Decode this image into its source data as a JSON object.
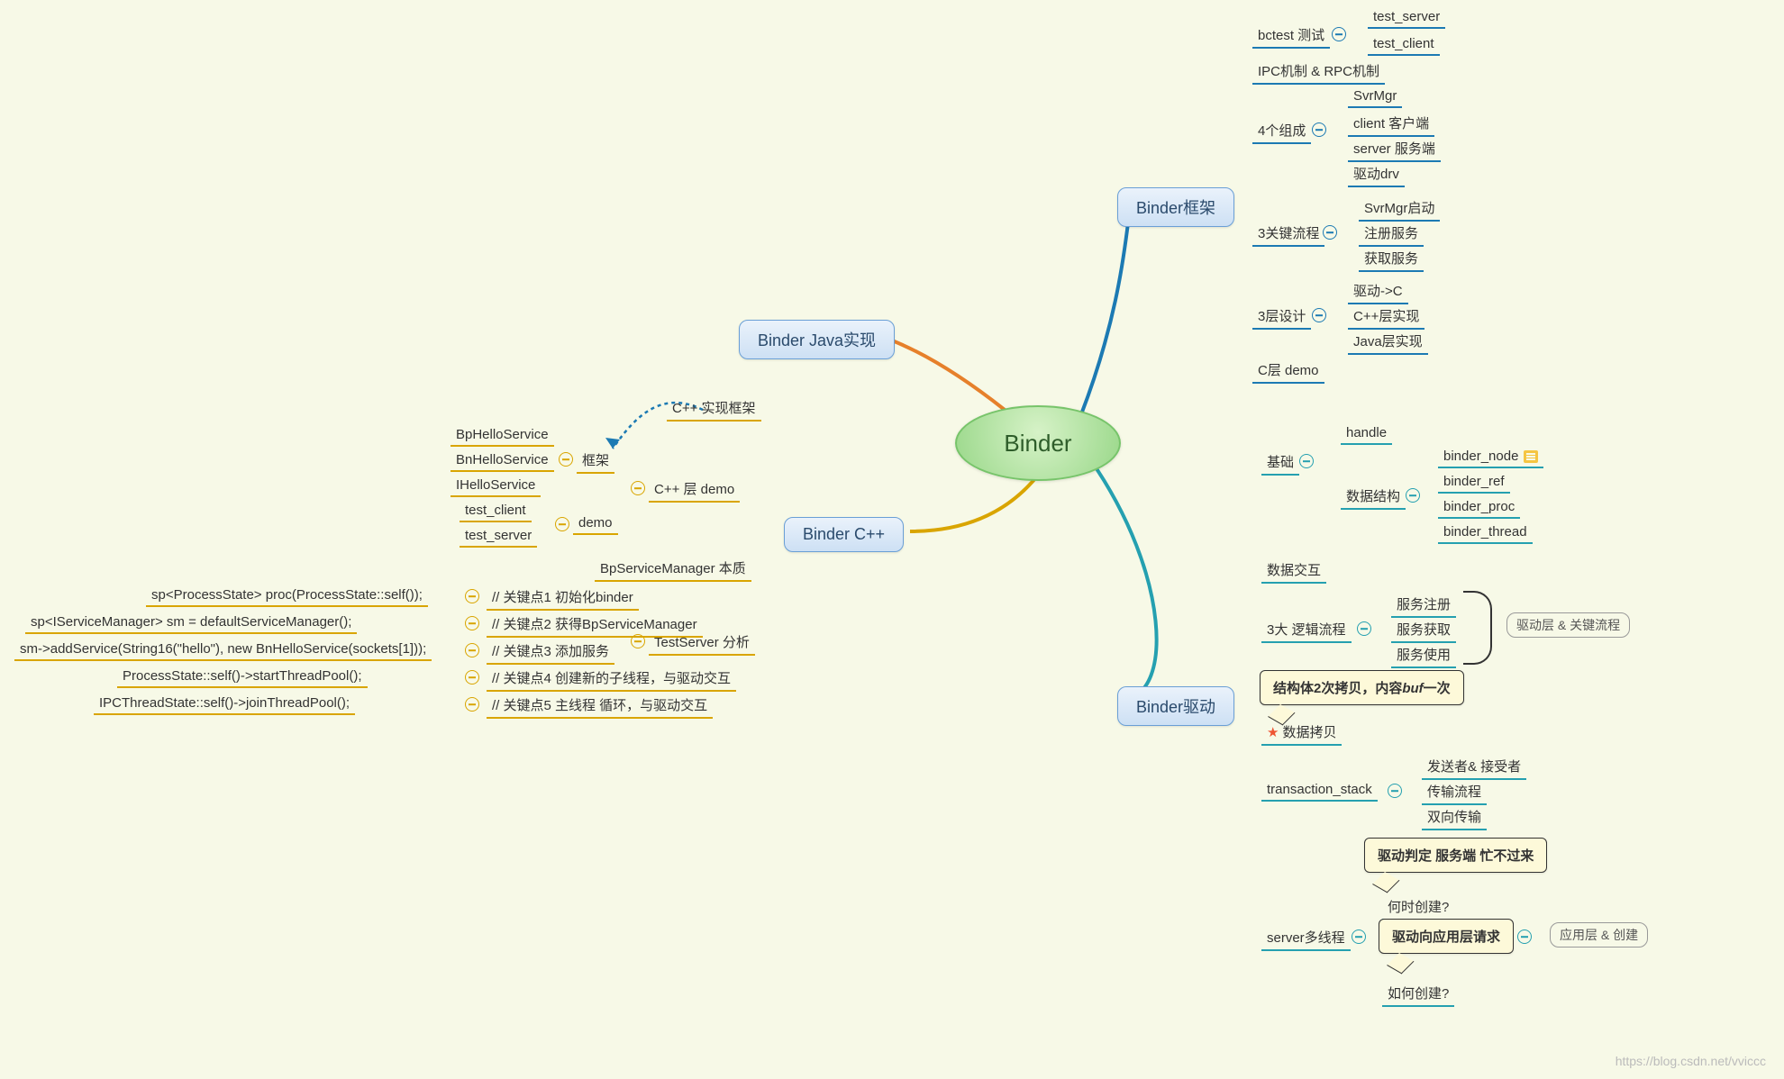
{
  "root": "Binder",
  "branches": {
    "java": {
      "label": "Binder Java实现"
    },
    "cpp": {
      "label": "Binder C++",
      "cpp_framework_label": "C++ 实现框架",
      "cpp_demo": {
        "label": "C++ 层  demo",
        "framework": {
          "label": "框架",
          "items": [
            "BpHelloService",
            "BnHelloService",
            "IHelloService"
          ]
        },
        "demo": {
          "label": "demo",
          "items": [
            "test_client",
            "test_server"
          ]
        }
      },
      "testserver": {
        "label": "TestServer 分析",
        "bp": "BpServiceManager 本质",
        "steps": [
          {
            "code": "sp<ProcessState> proc(ProcessState::self());",
            "note": "// 关键点1 初始化binder"
          },
          {
            "code": "sp<IServiceManager> sm = defaultServiceManager();",
            "note": "// 关键点2 获得BpServiceManager"
          },
          {
            "code": "sm->addService(String16(\"hello\"), new BnHelloService(sockets[1]));",
            "note": "// 关键点3 添加服务"
          },
          {
            "code": "ProcessState::self()->startThreadPool();",
            "note": "// 关键点4 创建新的子线程，与驱动交互"
          },
          {
            "code": "IPCThreadState::self()->joinThreadPool();",
            "note": "// 关键点5 主线程 循环，与驱动交互"
          }
        ]
      }
    },
    "framework": {
      "label": "Binder框架",
      "bctest": {
        "label": "bctest 测试",
        "items": [
          "test_server",
          "test_client"
        ]
      },
      "ipc": "IPC机制 & RPC机制",
      "components": {
        "label": "4个组成",
        "items": [
          "SvrMgr",
          "client 客户端",
          "server 服务端",
          "驱动drv"
        ]
      },
      "flows": {
        "label": "3关键流程",
        "items": [
          "SvrMgr启动",
          "注册服务",
          "获取服务"
        ]
      },
      "layers": {
        "label": "3层设计",
        "items": [
          "驱动->C",
          "C++层实现",
          "Java层实现"
        ]
      },
      "cdemo": "C层 demo"
    },
    "driver": {
      "label": "Binder驱动",
      "basic": {
        "label": "基础",
        "handle": "handle",
        "struct": {
          "label": "数据结构",
          "items": [
            "binder_node",
            "binder_ref",
            "binder_proc",
            "binder_thread"
          ]
        }
      },
      "exchange": "数据交互",
      "logic": {
        "label": "3大 逻辑流程",
        "items": [
          "服务注册",
          "服务获取",
          "服务使用"
        ],
        "tag": "驱动层 & 关键流程"
      },
      "copy": {
        "star": "数据拷贝",
        "bubble_a": "结构体2次拷贝，内容",
        "bubble_b": "buf",
        "bubble_c": "一次"
      },
      "tstack": {
        "label": "transaction_stack",
        "items": [
          "发送者& 接受者",
          "传输流程",
          "双向传输"
        ]
      },
      "server_mt": {
        "label": "server多线程",
        "when": "何时创建?",
        "how": "如何创建?",
        "bubble": "驱动判定 服务端 忙不过来",
        "req": "驱动向应用层请求",
        "tag": "应用层 & 创建"
      }
    }
  },
  "watermark": "https://blog.csdn.net/vviccc"
}
